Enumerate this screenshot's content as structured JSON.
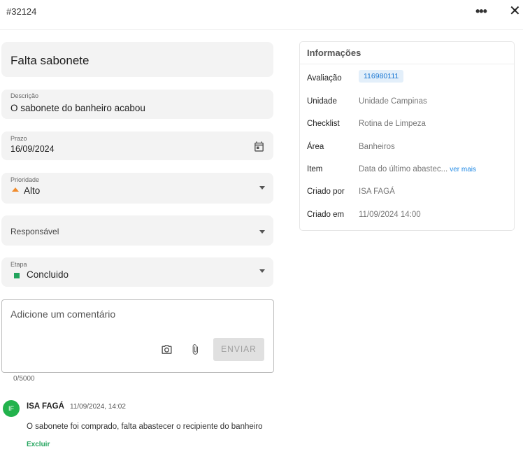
{
  "header": {
    "ticket_id": "#32124",
    "more_glyph": "•••",
    "close_glyph": "✕"
  },
  "form": {
    "title": "Falta sabonete",
    "description": {
      "label": "Descrição",
      "value": "O sabonete do banheiro acabou"
    },
    "due": {
      "label": "Prazo",
      "value": "16/09/2024"
    },
    "priority": {
      "label": "Prioridade",
      "value": "Alto",
      "color": "#f08c2e"
    },
    "assignee": {
      "label": "Responsável"
    },
    "stage": {
      "label": "Etapa",
      "value": "Concluido",
      "color": "#22a45d"
    }
  },
  "comment": {
    "placeholder": "Adicione um comentário",
    "send_label": "ENVIAR",
    "counter": "0/5000"
  },
  "comments": [
    {
      "initials": "IF",
      "author": "ISA FAGÁ",
      "date": "11/09/2024, 14:02",
      "text": "O sabonete foi comprado, falta abastecer o recipiente do banheiro",
      "delete_label": "Excluir"
    }
  ],
  "info": {
    "title": "Informações",
    "rows": [
      {
        "label": "Avaliação",
        "value": "116980111"
      },
      {
        "label": "Unidade",
        "value": "Unidade Campinas"
      },
      {
        "label": "Checklist",
        "value": "Rotina de Limpeza"
      },
      {
        "label": "Área",
        "value": "Banheiros"
      },
      {
        "label": "Item",
        "value": "Data do último abastec...",
        "link": "ver mais"
      },
      {
        "label": "Criado por",
        "value": "ISA FAGÁ"
      },
      {
        "label": "Criado em",
        "value": "11/09/2024 14:00"
      }
    ]
  },
  "colors": {
    "accent_green": "#22a45d",
    "link_blue": "#1e88e5"
  }
}
